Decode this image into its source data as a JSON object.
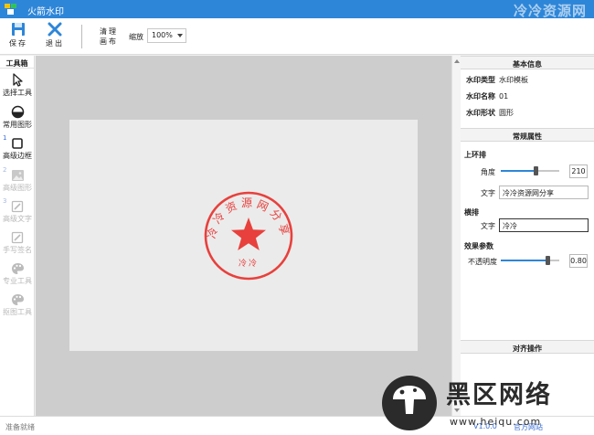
{
  "titlebar": {
    "app_title": "火箭水印",
    "brand_watermark": "冷冷资源网"
  },
  "toolbar": {
    "save_label": "保存",
    "exit_label": "退出",
    "clear_line1": "清理",
    "clear_line2": "画布",
    "zoom_label": "缩放",
    "zoom_value": "100%"
  },
  "toolbox": {
    "title": "工具箱",
    "tools": [
      {
        "label": "选择工具",
        "num": "",
        "disabled": false
      },
      {
        "label": "常用图形",
        "num": "",
        "disabled": false
      },
      {
        "label": "高级边框",
        "num": "1",
        "disabled": false
      },
      {
        "label": "高级图形",
        "num": "2",
        "disabled": true
      },
      {
        "label": "高级文字",
        "num": "3",
        "disabled": true
      },
      {
        "label": "手写签名",
        "num": "",
        "disabled": true
      },
      {
        "label": "专业工具",
        "num": "",
        "disabled": true
      },
      {
        "label": "抠图工具",
        "num": "",
        "disabled": true
      }
    ]
  },
  "seal": {
    "arc_text": "冷冷资源网分享",
    "bottom_text": "冷冷",
    "color": "#e8403c"
  },
  "panel": {
    "basic_info_title": "基本信息",
    "info": [
      {
        "key": "水印类型",
        "value": "水印模板"
      },
      {
        "key": "水印名称",
        "value": "01"
      },
      {
        "key": "水印形状",
        "value": "圆形"
      }
    ],
    "general_title": "常规属性",
    "upper_arc": {
      "title": "上环排",
      "angle_label": "角度",
      "angle_value": "210",
      "angle_fraction": 0.6,
      "text_label": "文字",
      "text_value": "冷冷资源网分享"
    },
    "horizontal": {
      "title": "横排",
      "text_label": "文字",
      "text_value": "冷冷"
    },
    "effect": {
      "title": "效果参数",
      "opacity_label": "不透明度",
      "opacity_value": "0.80",
      "opacity_fraction": 0.8
    },
    "align_title": "对齐操作"
  },
  "statusbar": {
    "ready_text": "准备就绪",
    "version_link": "V1.0.0",
    "site_link": "官方网站"
  },
  "corner_logo": {
    "name": "黑区网络",
    "url": "www.heiqu.com"
  },
  "colors": {
    "accent": "#2e86d8",
    "seal_red": "#e8403c"
  }
}
